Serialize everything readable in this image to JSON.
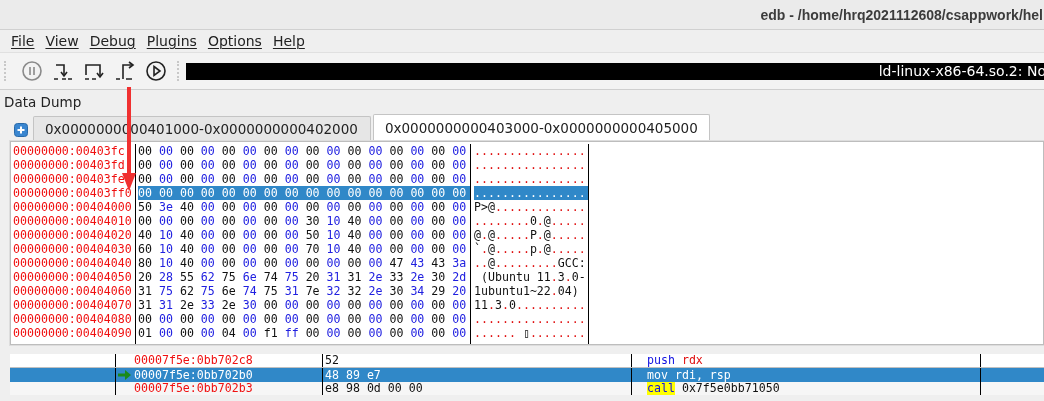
{
  "window": {
    "title": "edb - /home/hrq2021112608/csappwork/hel"
  },
  "menu": [
    "File",
    "View",
    "Debug",
    "Plugins",
    "Options",
    "Help"
  ],
  "toolbar": {
    "buttons": [
      {
        "kind": "pause",
        "disabled": true
      },
      {
        "kind": "step-into",
        "disabled": false
      },
      {
        "kind": "step-over",
        "disabled": false
      },
      {
        "kind": "step-out",
        "disabled": false
      },
      {
        "kind": "run",
        "disabled": false
      }
    ],
    "status": "ld-linux-x86-64.so.2: No"
  },
  "data_dump": {
    "title": "Data Dump",
    "tabs": [
      {
        "label": "0x0000000000401000-0x0000000000402000",
        "selected": false
      },
      {
        "label": "0x0000000000403000-0x0000000000405000",
        "selected": true
      }
    ],
    "rows": [
      {
        "address": "00000000:00403fc",
        "bytes": "00 00 00 00 00 00 00 00 00 00 00 00 00 00 00 00",
        "ascii": "................",
        "selected": false
      },
      {
        "address": "00000000:00403fd",
        "bytes": "00 00 00 00 00 00 00 00 00 00 00 00 00 00 00 00",
        "ascii": "................",
        "selected": false
      },
      {
        "address": "00000000:00403fe",
        "bytes": "00 00 00 00 00 00 00 00 00 00 00 00 00 00 00 00",
        "ascii": "................",
        "selected": false
      },
      {
        "address": "00000000:00403ff0",
        "bytes": "00 00 00 00 00 00 00 00 00 00 00 00 00 00 00 00",
        "ascii": "................",
        "selected": true
      },
      {
        "address": "00000000:00404000",
        "bytes": "50 3e 40 00 00 00 00 00 00 00 00 00 00 00 00 00",
        "ascii": "P>@.............",
        "selected": false
      },
      {
        "address": "00000000:00404010",
        "bytes": "00 00 00 00 00 00 00 00 30 10 40 00 00 00 00 00",
        "ascii": "........0.@.....",
        "selected": false
      },
      {
        "address": "00000000:00404020",
        "bytes": "40 10 40 00 00 00 00 00 50 10 40 00 00 00 00 00",
        "ascii": "@.@.....P.@.....",
        "selected": false
      },
      {
        "address": "00000000:00404030",
        "bytes": "60 10 40 00 00 00 00 00 70 10 40 00 00 00 00 00",
        "ascii": "`.@.....p.@.....",
        "selected": false
      },
      {
        "address": "00000000:00404040",
        "bytes": "80 10 40 00 00 00 00 00 00 00 00 00 47 43 43 3a",
        "ascii": "..@.........GCC:",
        "selected": false
      },
      {
        "address": "00000000:00404050",
        "bytes": "20 28 55 62 75 6e 74 75 20 31 31 2e 33 2e 30 2d",
        "ascii": " (Ubuntu 11.3.0-",
        "selected": false
      },
      {
        "address": "00000000:00404060",
        "bytes": "31 75 62 75 6e 74 75 31 7e 32 32 2e 30 34 29 20",
        "ascii": "1ubuntu1~22.04)",
        "selected": false
      },
      {
        "address": "00000000:00404070",
        "bytes": "31 31 2e 33 2e 30 00 00 00 00 00 00 00 00 00 00",
        "ascii": "11.3.0..........",
        "selected": false
      },
      {
        "address": "00000000:00404080",
        "bytes": "00 00 00 00 00 00 00 00 00 00 00 00 00 00 00 00",
        "ascii": "................",
        "selected": false
      },
      {
        "address": "00000000:00404090",
        "bytes": "01 00 00 00 04 00 f1 ff 00 00 00 00 00 00 00 00",
        "ascii": "...... ▯........",
        "selected": false
      }
    ]
  },
  "disassembly": {
    "rows": [
      {
        "address": "00007f5e:0bb702c8",
        "bytes": "52",
        "mnemonic": "push",
        "operands": "rdx",
        "current": false,
        "selected": false
      },
      {
        "address": "00007f5e:0bb702b0",
        "bytes": "48 89 e7",
        "mnemonic": "mov",
        "operands": "rdi, rsp",
        "current": true,
        "selected": true
      },
      {
        "address": "00007f5e:0bb702b3",
        "bytes": "e8 98 0d 00 00",
        "mnemonic": "call",
        "operands": "0x7f5e0bb71050",
        "current": false,
        "selected": false
      }
    ]
  },
  "annotation": {
    "kind": "arrow"
  }
}
